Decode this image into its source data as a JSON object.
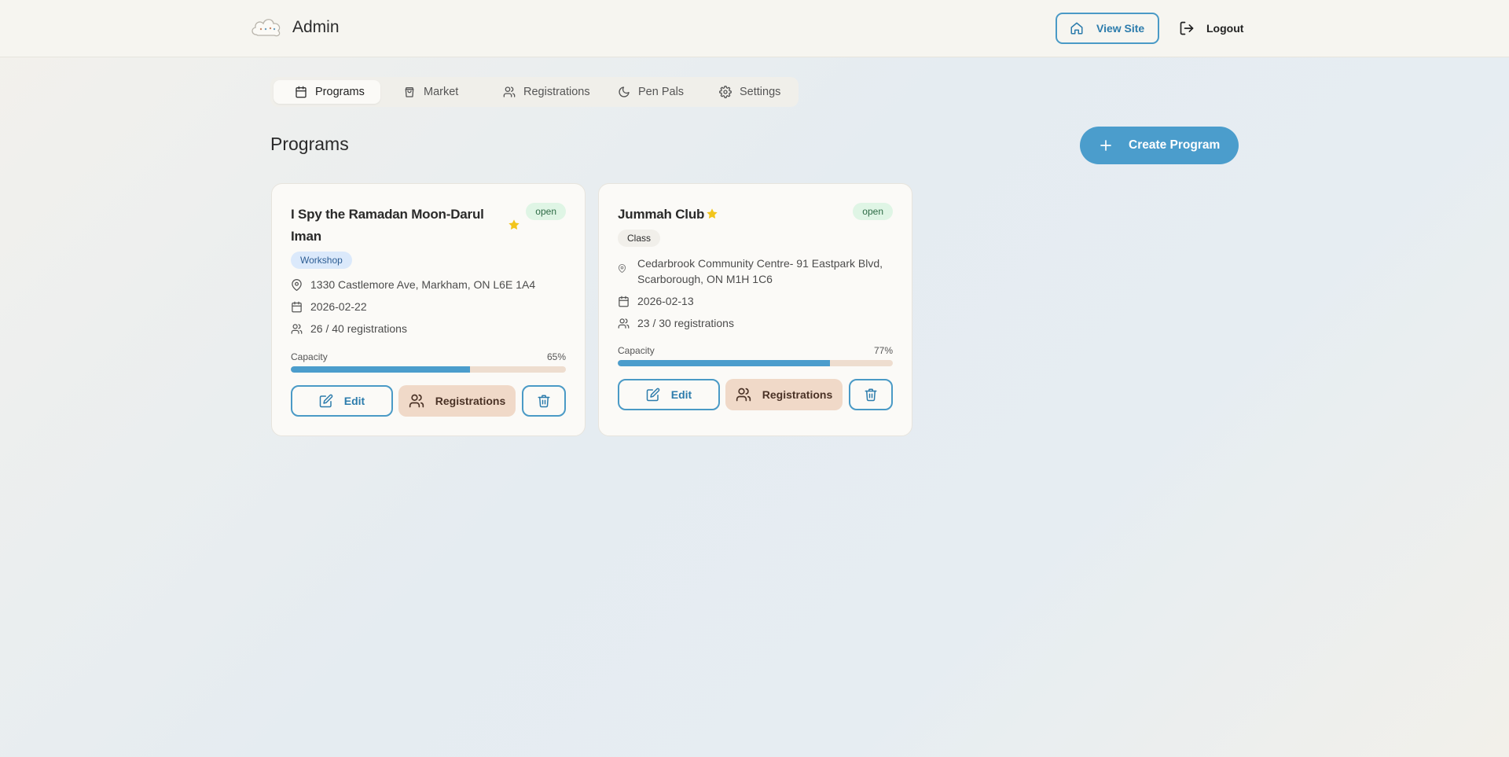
{
  "header": {
    "brand": "Admin",
    "view_site_label": "View Site",
    "logout_label": "Logout"
  },
  "tabs": [
    {
      "label": "Programs",
      "icon": "calendar-icon",
      "active": true
    },
    {
      "label": "Market",
      "icon": "shopping-bag-icon",
      "active": false
    },
    {
      "label": "Registrations",
      "icon": "users-icon",
      "active": false
    },
    {
      "label": "Pen Pals",
      "icon": "moon-icon",
      "active": false
    },
    {
      "label": "Settings",
      "icon": "gear-icon",
      "active": false
    }
  ],
  "page": {
    "title": "Programs",
    "create_label": "Create Program"
  },
  "programs": [
    {
      "title_line1": "I Spy the Ramadan Moon-Darul",
      "title_line2": "Iman",
      "featured": true,
      "status": "open",
      "type": "Workshop",
      "location_line1": "1330 Castlemore Ave, Markham, ON L6E 1A4",
      "location_line2": "",
      "date": "2026-02-22",
      "registrations": "26 / 40 registrations",
      "capacity_label": "Capacity",
      "capacity_pct": "65%",
      "capacity_fraction": 0.65,
      "edit_label": "Edit",
      "registrations_label": "Registrations"
    },
    {
      "title_line1": "Jummah Club",
      "title_line2": "",
      "featured": true,
      "status": "open",
      "type": "Class",
      "location_line1": "Cedarbrook Community Centre- 91 Eastpark Blvd,",
      "location_line2": "Scarborough, ON M1H 1C6",
      "date": "2026-02-13",
      "registrations": "23 / 30 registrations",
      "capacity_label": "Capacity",
      "capacity_pct": "77%",
      "capacity_fraction": 0.77,
      "edit_label": "Edit",
      "registrations_label": "Registrations"
    }
  ],
  "colors": {
    "accent": "#4b9dcc",
    "registrations_button": "#f0d9c8",
    "status_badge": "#dff5e5",
    "star": "#f2c51c"
  }
}
